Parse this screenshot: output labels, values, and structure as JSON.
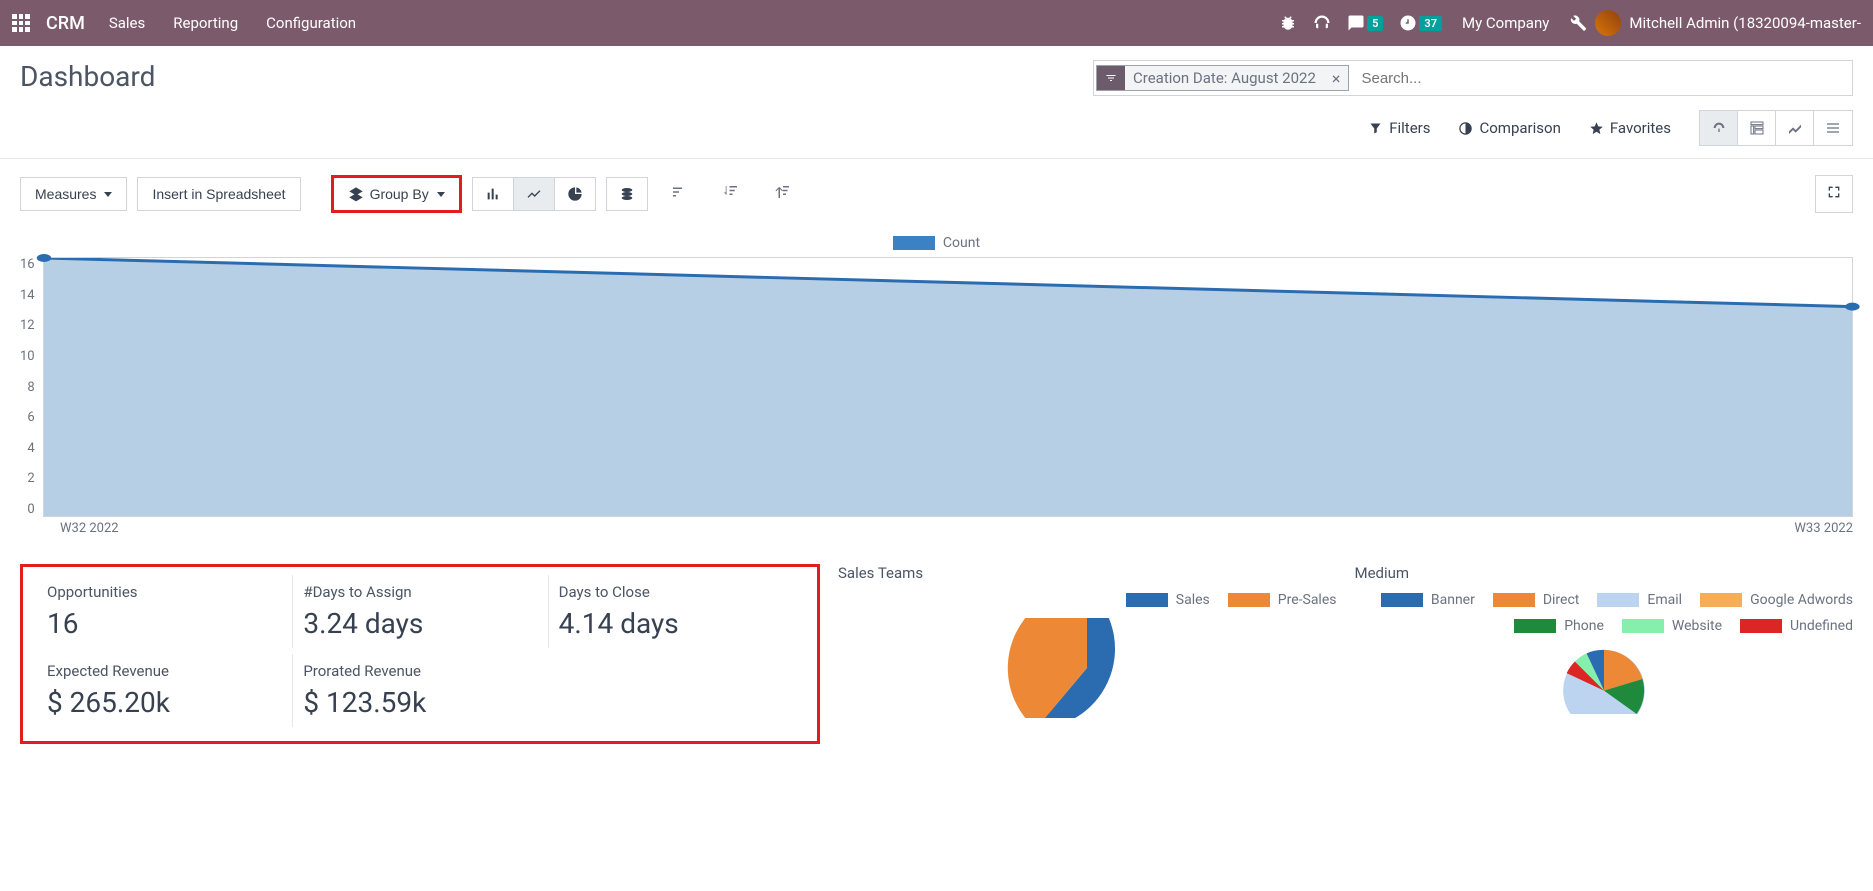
{
  "nav": {
    "brand": "CRM",
    "menu": [
      "Sales",
      "Reporting",
      "Configuration"
    ],
    "chat_badge": "5",
    "clock_badge": "37",
    "company": "My Company",
    "user": "Mitchell Admin (18320094-master-"
  },
  "header": {
    "title": "Dashboard",
    "search_placeholder": "Search...",
    "facet_label": "Creation Date: August 2022"
  },
  "filters": {
    "filters": "Filters",
    "comparison": "Comparison",
    "favorites": "Favorites"
  },
  "toolbar": {
    "measures": "Measures",
    "insert": "Insert in Spreadsheet",
    "groupby": "Group By"
  },
  "chart_data": {
    "type": "line",
    "legend": "Count",
    "y_ticks": [
      "16",
      "14",
      "12",
      "10",
      "8",
      "6",
      "4",
      "2",
      "0"
    ],
    "x_ticks": [
      "W32 2022",
      "W33 2022"
    ],
    "series": [
      {
        "name": "Count",
        "x": [
          "W32 2022",
          "W33 2022"
        ],
        "values": [
          16,
          13
        ]
      }
    ],
    "ylim": [
      0,
      16
    ]
  },
  "kpis": [
    {
      "label": "Opportunities",
      "value": "16"
    },
    {
      "label": "#Days to Assign",
      "value": "3.24 days"
    },
    {
      "label": "Days to Close",
      "value": "4.14 days"
    },
    {
      "label": "Expected Revenue",
      "value": "$ 265.20k"
    },
    {
      "label": "Prorated Revenue",
      "value": "$ 123.59k"
    }
  ],
  "sales_teams": {
    "title": "Sales Teams",
    "legend": [
      {
        "name": "Sales",
        "color": "#2b6cb0"
      },
      {
        "name": "Pre-Sales",
        "color": "#ed8936"
      }
    ]
  },
  "medium": {
    "title": "Medium",
    "legend": [
      {
        "name": "Banner",
        "color": "#2b6cb0"
      },
      {
        "name": "Direct",
        "color": "#ed8936"
      },
      {
        "name": "Email",
        "color": "#bcd4f0"
      },
      {
        "name": "Google Adwords",
        "color": "#f6ad55"
      },
      {
        "name": "Phone",
        "color": "#1f8a3b"
      },
      {
        "name": "Website",
        "color": "#86efac"
      },
      {
        "name": "Undefined",
        "color": "#dc2626"
      }
    ]
  }
}
